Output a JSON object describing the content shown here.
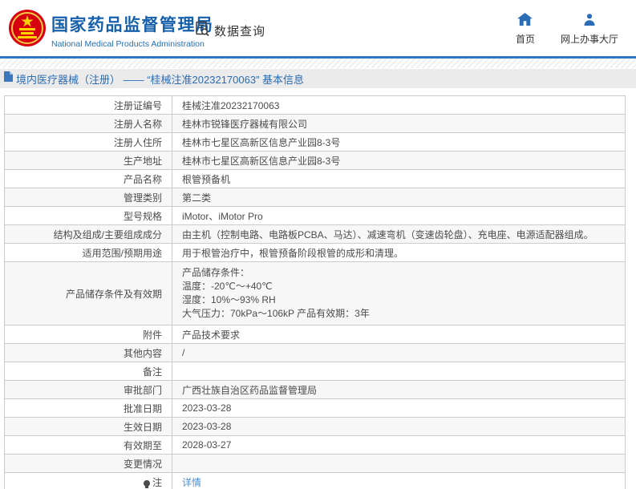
{
  "header": {
    "logo": {
      "title": "国家药品监督管理局",
      "subtitle": "National Medical Products Administration",
      "emblem_icon": "china-national-emblem"
    },
    "data_query": {
      "label": "数据查询",
      "icon": "document-search-icon"
    },
    "nav": [
      {
        "label": "首页",
        "icon": "home-icon"
      },
      {
        "label": "网上办事大厅",
        "icon": "user-icon"
      }
    ]
  },
  "breadcrumb": {
    "icon": "document-icon",
    "text": "境内医疗器械（注册） —— “桂械注准20232170063” 基本信息"
  },
  "table": {
    "rows": [
      {
        "label": "注册证编号",
        "value": "桂械注准20232170063"
      },
      {
        "label": "注册人名称",
        "value": "桂林市锐锋医疗器械有限公司"
      },
      {
        "label": "注册人住所",
        "value": "桂林市七星区高新区信息产业园8-3号"
      },
      {
        "label": "生产地址",
        "value": "桂林市七星区高新区信息产业园8-3号"
      },
      {
        "label": "产品名称",
        "value": "根管预备机"
      },
      {
        "label": "管理类别",
        "value": "第二类"
      },
      {
        "label": "型号规格",
        "value": "iMotor、iMotor Pro"
      },
      {
        "label": "结构及组成/主要组成成分",
        "value": "由主机（控制电路、电路板PCBA、马达）、减速弯机（变速齿轮盘）、充电座、电源适配器组成。"
      },
      {
        "label": "适用范围/预期用途",
        "value": "用于根管治疗中，根管预备阶段根管的成形和清理。"
      },
      {
        "label": "产品储存条件及有效期",
        "value_lines": [
          "产品储存条件：",
          "温度：-20℃～+40℃",
          "湿度：10%～93% RH",
          "大气压力：70kPa～106kP 产品有效期：3年"
        ]
      },
      {
        "label": "附件",
        "value": "产品技术要求"
      },
      {
        "label": "其他内容",
        "value": "/"
      },
      {
        "label": "备注",
        "value": ""
      },
      {
        "label": "审批部门",
        "value": "广西壮族自治区药品监督管理局"
      },
      {
        "label": "批准日期",
        "value": "2023-03-28"
      },
      {
        "label": "生效日期",
        "value": "2023-03-28"
      },
      {
        "label": "有效期至",
        "value": "2028-03-27"
      },
      {
        "label": "变更情况",
        "value": ""
      },
      {
        "label": "注",
        "label_icon": "note-icon",
        "value": "详情",
        "value_is_link": true
      }
    ]
  },
  "colors": {
    "brand_blue": "#1660ab",
    "divider_blue": "#2b77c2",
    "breadcrumb_text": "#2b6cb3",
    "breadcrumb_bg": "#ebebeb",
    "table_border": "#cccccc",
    "row_alt_bg": "#f7f7f7",
    "link_blue": "#4a8fd4",
    "emblem_red": "#d7000f",
    "emblem_gold": "#ffd200"
  }
}
